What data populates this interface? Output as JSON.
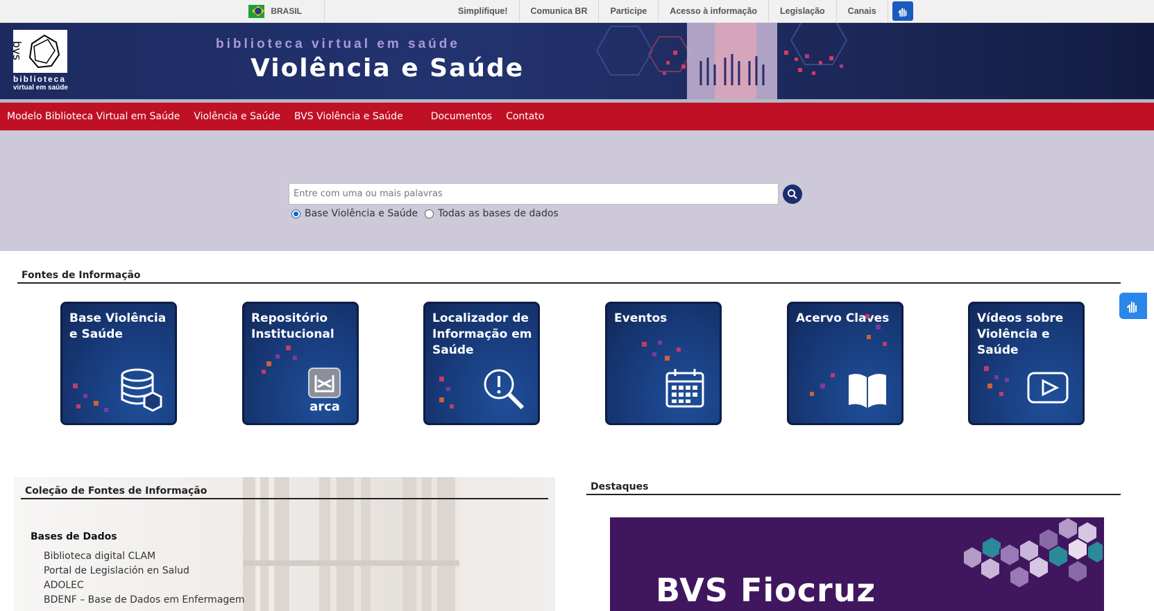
{
  "govbar": {
    "country": "BRASIL",
    "links": [
      "Simplifique!",
      "Comunica BR",
      "Participe",
      "Acesso à informação",
      "Legislação",
      "Canais"
    ]
  },
  "header": {
    "logo_line1": "biblioteca",
    "logo_line2": "virtual em saúde",
    "logo_mark": "bvs",
    "kicker": "biblioteca virtual em saúde",
    "title": "Violência e Saúde"
  },
  "nav": {
    "items": [
      "Modelo Biblioteca Virtual em Saúde",
      "Violência e Saúde",
      "BVS Violência e Saúde",
      "Documentos",
      "Contato"
    ]
  },
  "search": {
    "placeholder": "Entre com uma ou mais palavras",
    "options": [
      "Base Violência e Saúde",
      "Todas as bases de dados"
    ],
    "selected": "Base Violência e Saúde"
  },
  "sources": {
    "heading": "Fontes de Informação",
    "tiles": [
      {
        "label": "Base Violência e Saúde",
        "icon": "database-icon"
      },
      {
        "label": "Repositório Institucional",
        "icon": "arca-icon",
        "icon_text": "arca"
      },
      {
        "label": "Localizador de Informação em Saúde",
        "icon": "search-alert-icon"
      },
      {
        "label": "Eventos",
        "icon": "calendar-icon"
      },
      {
        "label": "Acervo Claves",
        "icon": "book-icon"
      },
      {
        "label": "Vídeos sobre Violência e Saúde",
        "icon": "play-icon"
      }
    ]
  },
  "collection": {
    "heading": "Coleção de Fontes de Informação",
    "subheading": "Bases de Dados",
    "items": [
      "Biblioteca digital CLAM",
      "Portal de Legislación en Salud",
      "ADOLEC",
      "BDENF – Base de Dados em Enfermagem"
    ]
  },
  "highlights": {
    "heading": "Destaques",
    "promo_text": "BVS Fiocruz"
  },
  "colors": {
    "nav_red": "#c01025",
    "banner_navy": "#1c2a60",
    "search_bg": "#cdc9d8",
    "tile_blue": "#183c7c",
    "promo_purple": "#40175e"
  }
}
